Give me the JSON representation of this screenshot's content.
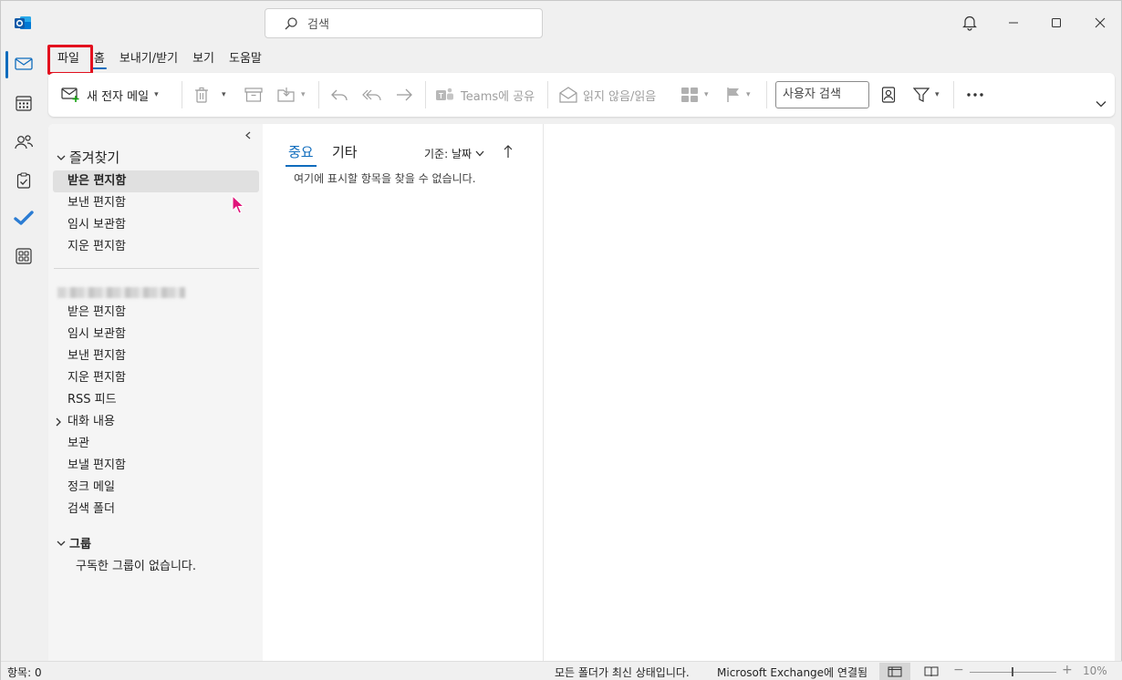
{
  "window": {
    "search_placeholder": "검색"
  },
  "ribbon_tabs": [
    {
      "label": "파일"
    },
    {
      "label": "홈"
    },
    {
      "label": "보내기/받기"
    },
    {
      "label": "보기"
    },
    {
      "label": "도움말"
    }
  ],
  "toolbar": {
    "new_mail": "새 전자 메일",
    "teams_share": "Teams에 공유",
    "unread_read": "읽지 않음/읽음",
    "people_search": "사용자 검색"
  },
  "folder_pane": {
    "favorites": {
      "header": "즐겨찾기",
      "items": [
        "받은 편지함",
        "보낸 편지함",
        "임시 보관함",
        "지운 편지함"
      ]
    },
    "account": {
      "items": [
        "받은 편지함",
        "임시 보관함",
        "보낸 편지함",
        "지운 편지함",
        "RSS 피드",
        "대화 내용",
        "보관",
        "보낼 편지함",
        "정크 메일",
        "검색 폴더"
      ]
    },
    "groups": {
      "header": "그룹",
      "empty": "구독한 그룹이 없습니다."
    }
  },
  "message_list": {
    "tab_focused": "중요",
    "tab_other": "기타",
    "sort_by": "기준: 날짜",
    "empty": "여기에 표시할 항목을 찾을 수 없습니다."
  },
  "statusbar": {
    "items_count": "항목: 0",
    "folder_status": "모든 폴더가 최신 상태입니다.",
    "connection": "Microsoft Exchange에 연결됨",
    "zoom": "10%"
  },
  "colors": {
    "accent": "#0f6cbd",
    "highlight": "#e3101e",
    "cursor": "#e0147a"
  }
}
